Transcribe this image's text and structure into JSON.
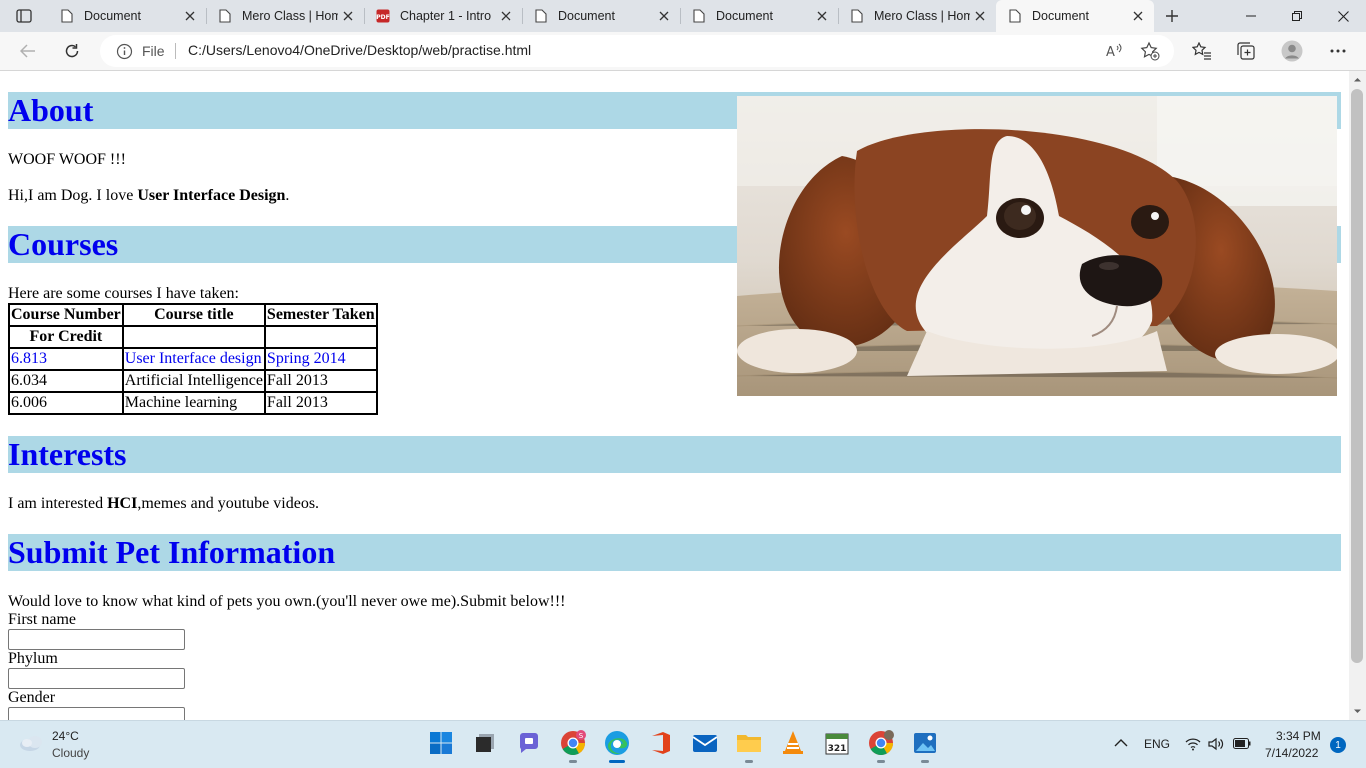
{
  "browser": {
    "tabs": [
      {
        "title": "Document",
        "icon": "page-icon"
      },
      {
        "title": "Mero Class | Hom",
        "icon": "page-icon"
      },
      {
        "title": "Chapter 1 - Intro",
        "icon": "pdf-icon"
      },
      {
        "title": "Document",
        "icon": "page-icon"
      },
      {
        "title": "Document",
        "icon": "page-icon"
      },
      {
        "title": "Mero Class | Hom",
        "icon": "page-icon"
      },
      {
        "title": "Document",
        "icon": "page-icon",
        "active": true
      }
    ],
    "address": {
      "scheme_label": "File",
      "url": "C:/Users/Lenovo4/OneDrive/Desktop/web/practise.html"
    },
    "accent": "#0078d4"
  },
  "page": {
    "about": {
      "heading": "About",
      "line1": "WOOF WOOF !!!",
      "intro_prefix": "Hi,I am Dog. I love ",
      "intro_bold": "User Interface Design",
      "intro_suffix": "."
    },
    "courses": {
      "heading": "Courses",
      "intro": "Here are some courses I have taken:",
      "headers": [
        "Course Number",
        "Course title",
        "Semester Taken"
      ],
      "subheader": "For Credit",
      "rows": [
        {
          "number": "6.813",
          "title": "User Interface design",
          "semester": "Spring 2014",
          "link": true
        },
        {
          "number": "6.034",
          "title": "Artificial Intelligence",
          "semester": "Fall 2013",
          "link": false
        },
        {
          "number": "6.006",
          "title": "Machine learning",
          "semester": "Fall 2013",
          "link": false
        }
      ]
    },
    "interests": {
      "heading": "Interests",
      "text_prefix": "I am interested ",
      "text_bold": "HCI",
      "text_suffix": ",memes and youtube videos."
    },
    "submit": {
      "heading": "Submit Pet Information",
      "intro": "Would love to know what kind of pets you own.(you'll never owe me).Submit below!!!",
      "fields": [
        {
          "label": "First name",
          "value": ""
        },
        {
          "label": "Phylum",
          "value": ""
        },
        {
          "label": "Gender",
          "value": ""
        }
      ]
    },
    "heading_bg": "#add8e6",
    "heading_color": "#0000ee"
  },
  "taskbar": {
    "weather_temp": "24°C",
    "weather_desc": "Cloudy",
    "apps": [
      "windows-start-icon",
      "task-view-icon",
      "teams-chat-icon",
      "chrome-icon",
      "edge-icon",
      "office-icon",
      "mail-icon",
      "file-explorer-icon",
      "vlc-icon",
      "calendar-icon",
      "chrome-profile-icon",
      "photos-icon"
    ],
    "language": "ENG",
    "time": "3:34 PM",
    "date": "7/14/2022",
    "notification_count": "1"
  }
}
